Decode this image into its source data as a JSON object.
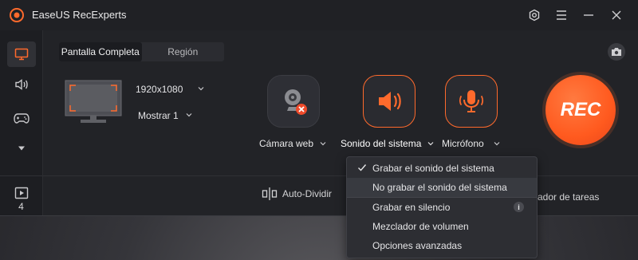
{
  "app": {
    "title": "EaseUS RecExperts"
  },
  "tabs": [
    {
      "label": "Pantalla Completa",
      "active": true
    },
    {
      "label": "Región",
      "active": false
    }
  ],
  "screen": {
    "resolution": "1920x1080",
    "display": "Mostrar 1"
  },
  "sources": {
    "webcam_label": "Cámara web",
    "webcam_enabled": false,
    "system_sound_label": "Sonido del sistema",
    "microphone_label": "Micrófono"
  },
  "rec_button": {
    "label": "REC"
  },
  "bottom": {
    "auto_split": "Auto-Dividir",
    "task_scheduler_partial": "mador de tareas"
  },
  "sidebar": {
    "recordings_count": "4"
  },
  "sound_menu": {
    "items": [
      {
        "label": "Grabar el sonido del sistema",
        "checked": true
      },
      {
        "label": "No grabar el sonido del sistema",
        "checked": false
      },
      {
        "label": "Grabar en silencio",
        "checked": false,
        "info": "i"
      },
      {
        "label": "Mezclador de volumen",
        "checked": false
      },
      {
        "label": "Opciones avanzadas",
        "checked": false
      }
    ]
  },
  "colors": {
    "accent": "#ff6a2c",
    "background": "#222327",
    "menu_bg": "#2d2e33"
  },
  "icons": [
    "app-logo-icon",
    "settings-icon",
    "menu-icon",
    "minimize-icon",
    "close-icon",
    "monitor-icon",
    "speaker-icon",
    "gamepad-icon",
    "chevron-down-icon",
    "play-folder-icon",
    "camera-icon",
    "webcam-icon",
    "microphone-icon",
    "auto-split-icon",
    "check-icon",
    "info-icon"
  ]
}
